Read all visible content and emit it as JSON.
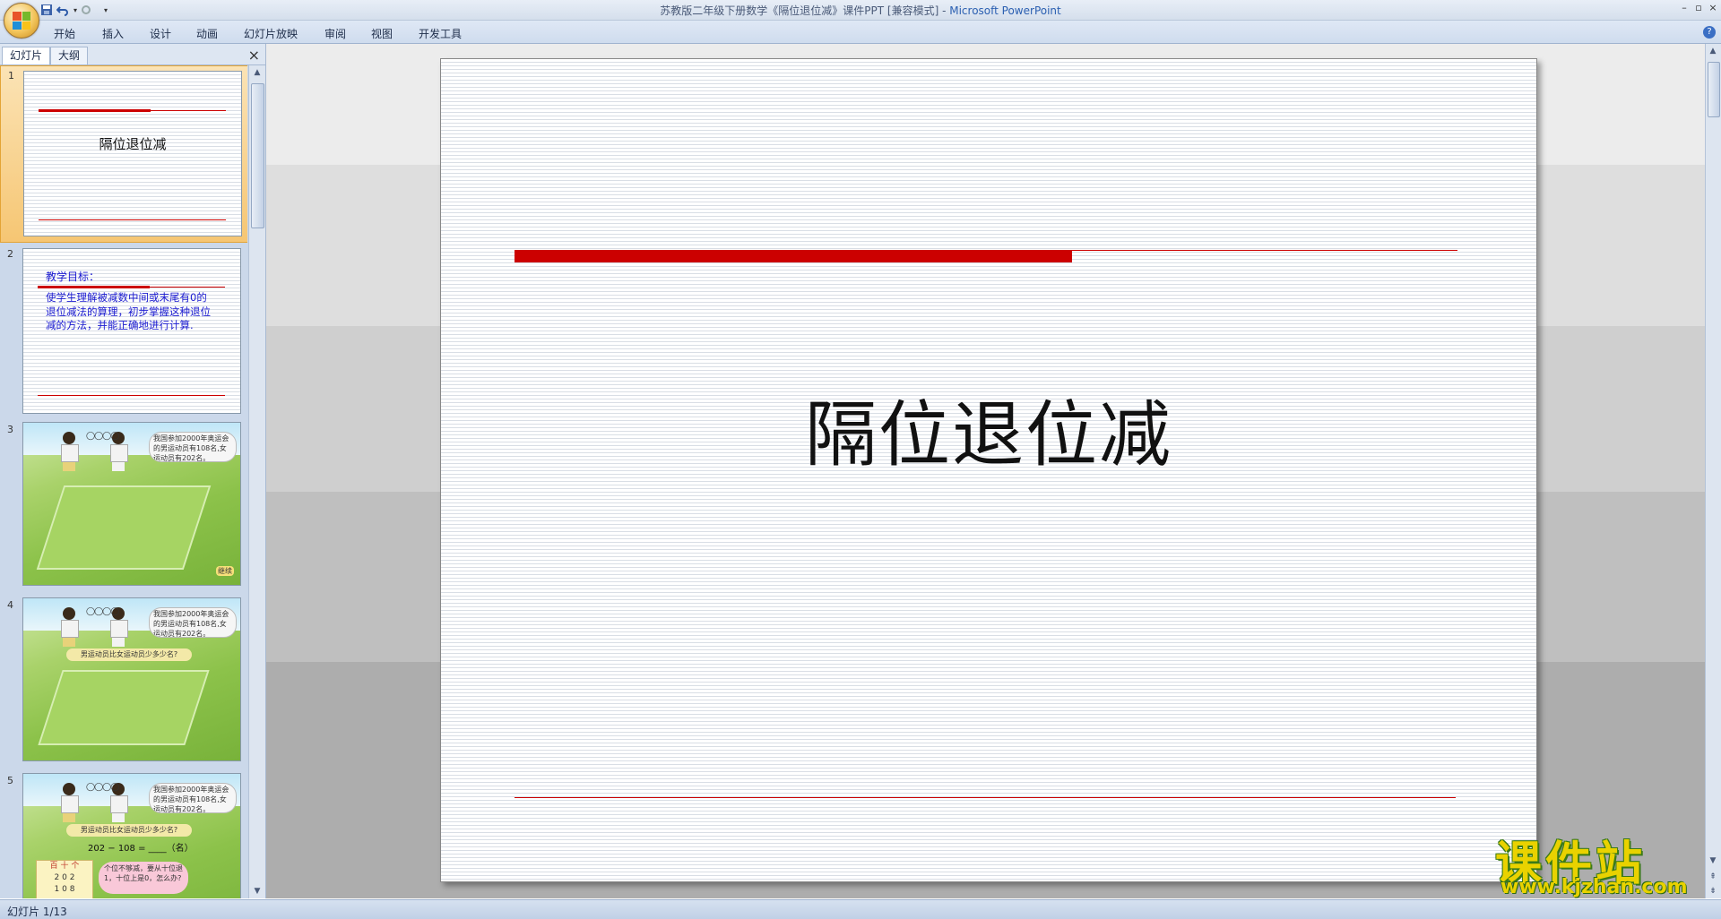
{
  "window": {
    "title_doc": "苏教版二年级下册数学《隔位退位减》课件PPT [兼容模式] -",
    "title_app": "Microsoft PowerPoint"
  },
  "ribbon": {
    "tabs": [
      "开始",
      "插入",
      "设计",
      "动画",
      "幻灯片放映",
      "审阅",
      "视图",
      "开发工具"
    ]
  },
  "pane": {
    "tabs": [
      "幻灯片",
      "大纲"
    ],
    "close_glyph": "×"
  },
  "thumbnails": [
    {
      "num": "1",
      "title": "隔位退位减"
    },
    {
      "num": "2",
      "heading": "教学目标：",
      "body": "使学生理解被减数中间或末尾有0的退位减法的算理，初步掌握这种退位减的方法，并能正确地进行计算."
    },
    {
      "num": "3",
      "bubble": "我国参加2000年奥运会的男运动员有108名,女运动员有202名。",
      "button": "继续"
    },
    {
      "num": "4",
      "bubble": "我国参加2000年奥运会的男运动员有108名,女运动员有202名。",
      "question": "男运动员比女运动员少多少名?"
    },
    {
      "num": "5",
      "bubble": "我国参加2000年奥运会的男运动员有108名,女运动员有202名。",
      "question": "男运动员比女运动员少多少名?",
      "equation": "202 − 108 = ____（名）",
      "table_head": "百 十 个",
      "table_row1": "2 0 2",
      "table_row2": "1 0 8",
      "hint": "个位不够减，要从十位退1，十位上是0，怎么办?"
    }
  ],
  "slide": {
    "title": "隔位退位减"
  },
  "status": {
    "text": "幻灯片 1/13"
  },
  "watermark": {
    "cn": "课件站",
    "url": "www.kjzhan.com"
  },
  "colors": {
    "accent_red": "#cc0000",
    "ribbon_blue": "#cfdcee"
  }
}
